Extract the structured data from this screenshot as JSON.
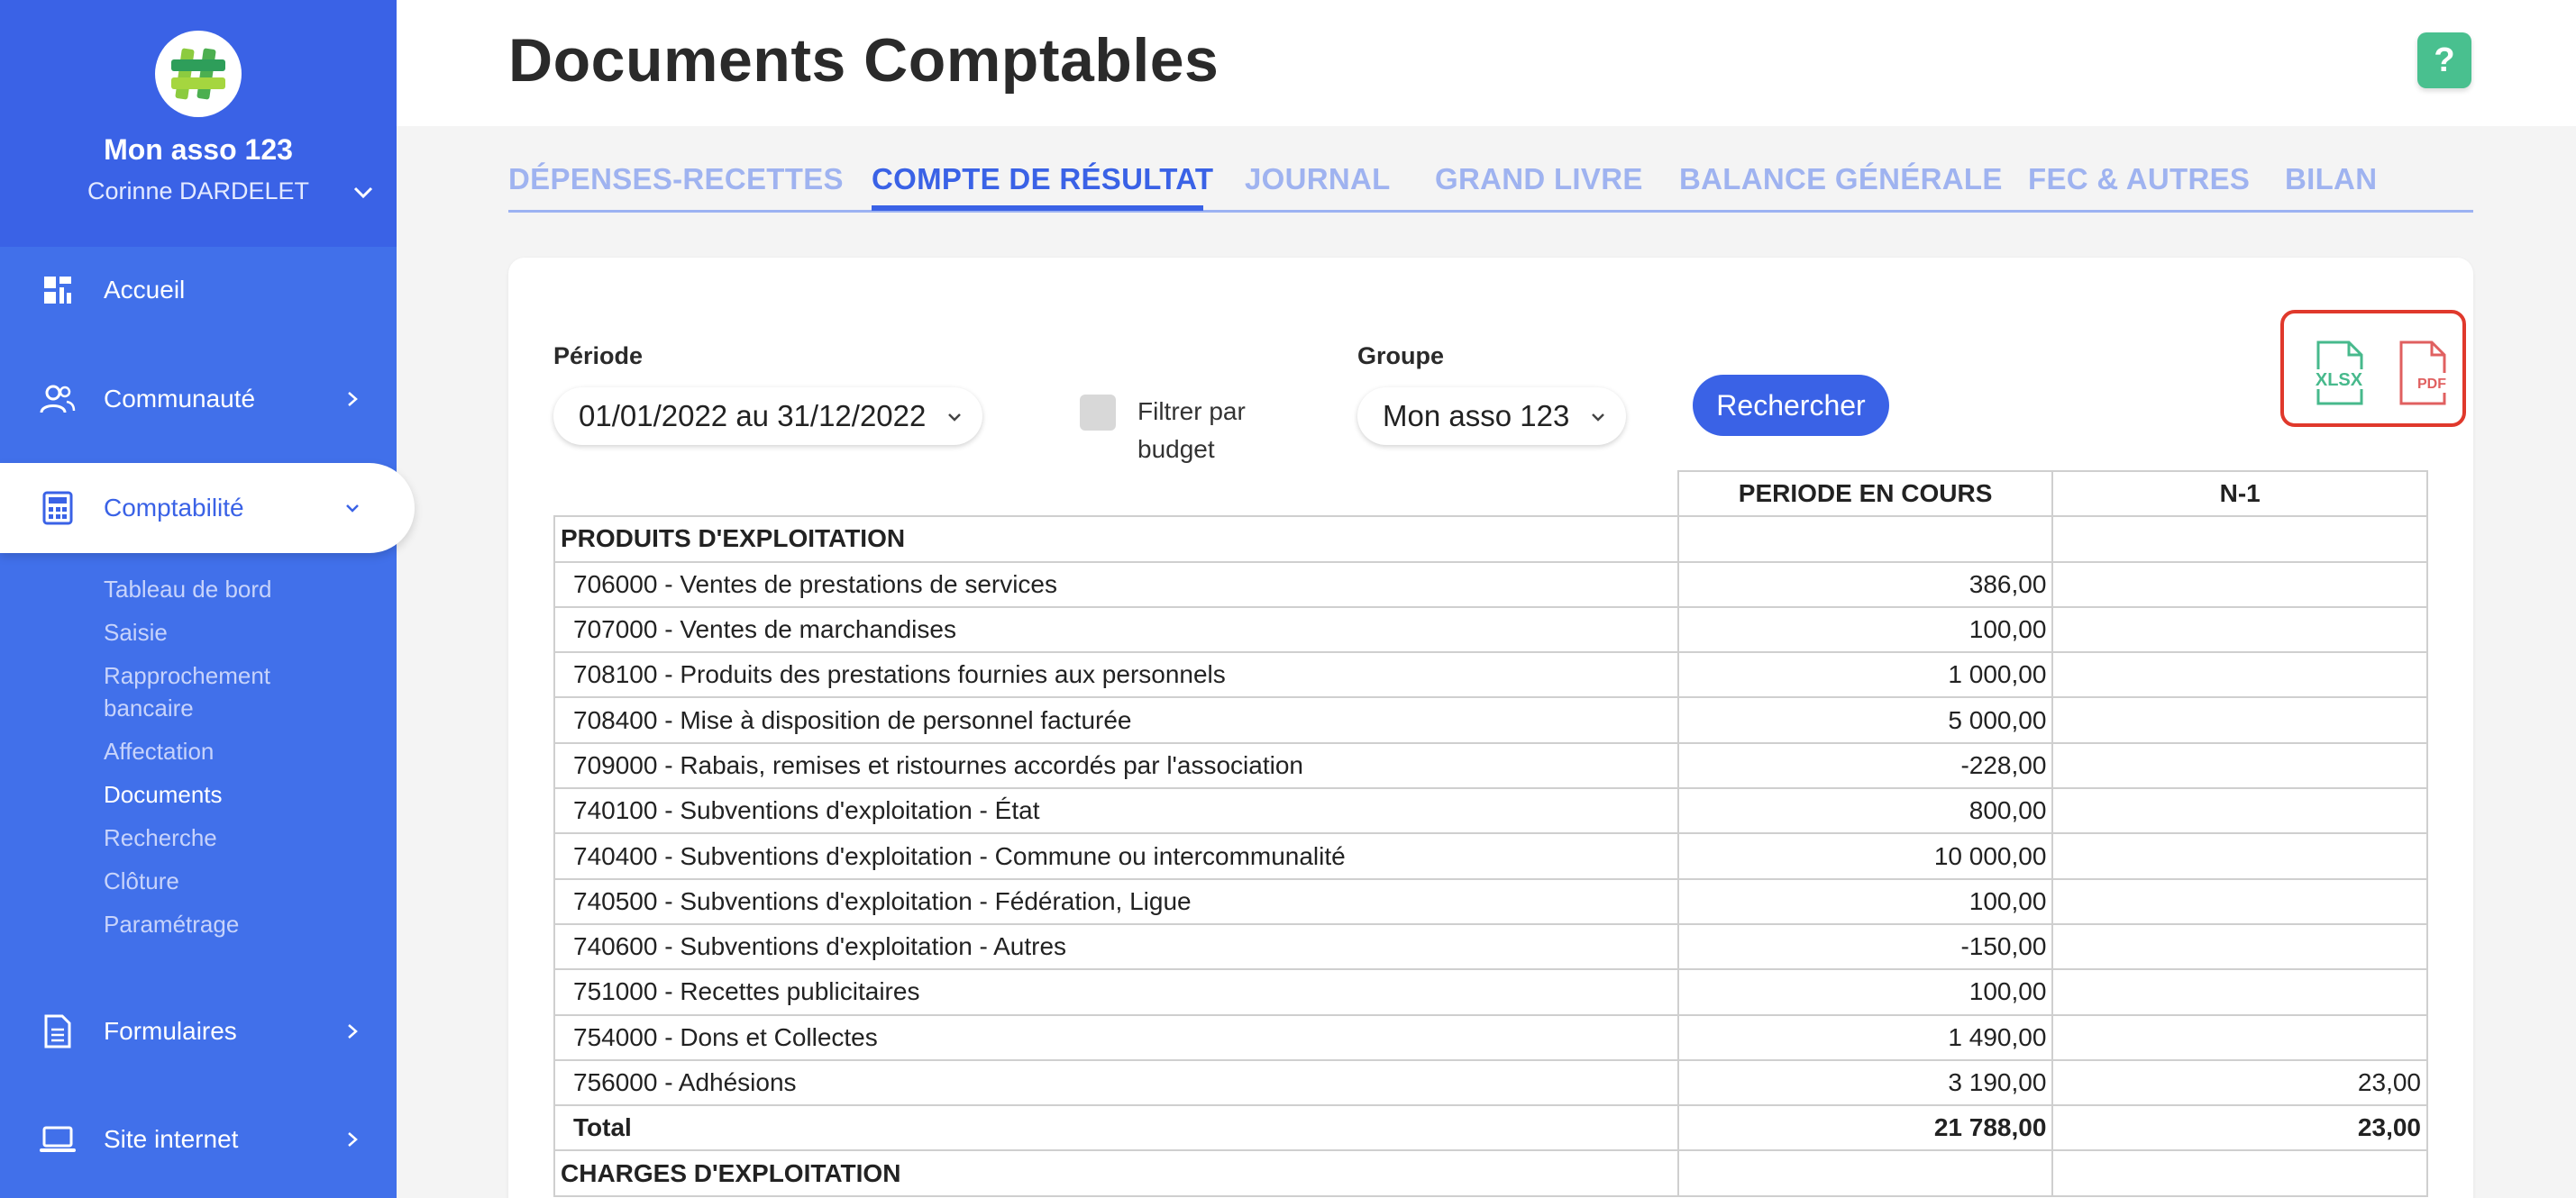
{
  "sidebar": {
    "org_name": "Mon asso 123",
    "user_name": "Corinne DARDELET",
    "nav": {
      "home": "Accueil",
      "community": "Communauté",
      "accounting": "Comptabilité",
      "forms": "Formulaires",
      "website": "Site internet"
    },
    "subnav": [
      "Tableau de bord",
      "Saisie",
      "Rapprochement bancaire",
      "Affectation",
      "Documents",
      "Recherche",
      "Clôture",
      "Paramétrage"
    ],
    "current_subnav": "Documents"
  },
  "header": {
    "title": "Documents Comptables",
    "help_label": "?"
  },
  "tabs": [
    "DÉPENSES-RECETTES",
    "COMPTE DE RÉSULTAT",
    "JOURNAL",
    "GRAND LIVRE",
    "BALANCE GÉNÉRALE",
    "FEC & AUTRES",
    "BILAN"
  ],
  "active_tab": "COMPTE DE RÉSULTAT",
  "filters": {
    "period_label": "Période",
    "period_value": "01/01/2022 au 31/12/2022",
    "budget_filter_label_line1": "Filtrer par",
    "budget_filter_label_line2": "budget",
    "budget_filter_checked": false,
    "group_label": "Groupe",
    "group_value": "Mon asso 123",
    "search_button": "Rechercher"
  },
  "exports": {
    "xlsx_label": "XLSX",
    "pdf_label": "PDF"
  },
  "colors": {
    "brand": "#3a62e6",
    "sidebar": "#4170ea",
    "help": "#49c08f",
    "highlight": "#e0392c"
  },
  "table": {
    "columns": [
      "PERIODE EN COURS",
      "N-1"
    ],
    "sections": [
      {
        "title": "PRODUITS D'EXPLOITATION",
        "rows": [
          {
            "label": "706000 - Ventes de prestations de services",
            "current": "386,00",
            "previous": ""
          },
          {
            "label": "707000 - Ventes de marchandises",
            "current": "100,00",
            "previous": ""
          },
          {
            "label": "708100 - Produits des prestations fournies aux personnels",
            "current": "1 000,00",
            "previous": ""
          },
          {
            "label": "708400 - Mise à disposition de personnel facturée",
            "current": "5 000,00",
            "previous": ""
          },
          {
            "label": "709000 - Rabais, remises et ristournes accordés par l'association",
            "current": "-228,00",
            "previous": ""
          },
          {
            "label": "740100 - Subventions d'exploitation - État",
            "current": "800,00",
            "previous": ""
          },
          {
            "label": "740400 - Subventions d'exploitation - Commune ou intercommunalité",
            "current": "10 000,00",
            "previous": ""
          },
          {
            "label": "740500 - Subventions d'exploitation - Fédération, Ligue",
            "current": "100,00",
            "previous": ""
          },
          {
            "label": "740600 - Subventions d'exploitation - Autres",
            "current": "-150,00",
            "previous": ""
          },
          {
            "label": "751000 - Recettes publicitaires",
            "current": "100,00",
            "previous": ""
          },
          {
            "label": "754000 - Dons et Collectes",
            "current": "1 490,00",
            "previous": ""
          },
          {
            "label": "756000 - Adhésions",
            "current": "3 190,00",
            "previous": "23,00"
          }
        ],
        "total": {
          "label": "Total",
          "current": "21 788,00",
          "previous": "23,00"
        }
      },
      {
        "title": "CHARGES D'EXPLOITATION",
        "rows": []
      }
    ]
  }
}
